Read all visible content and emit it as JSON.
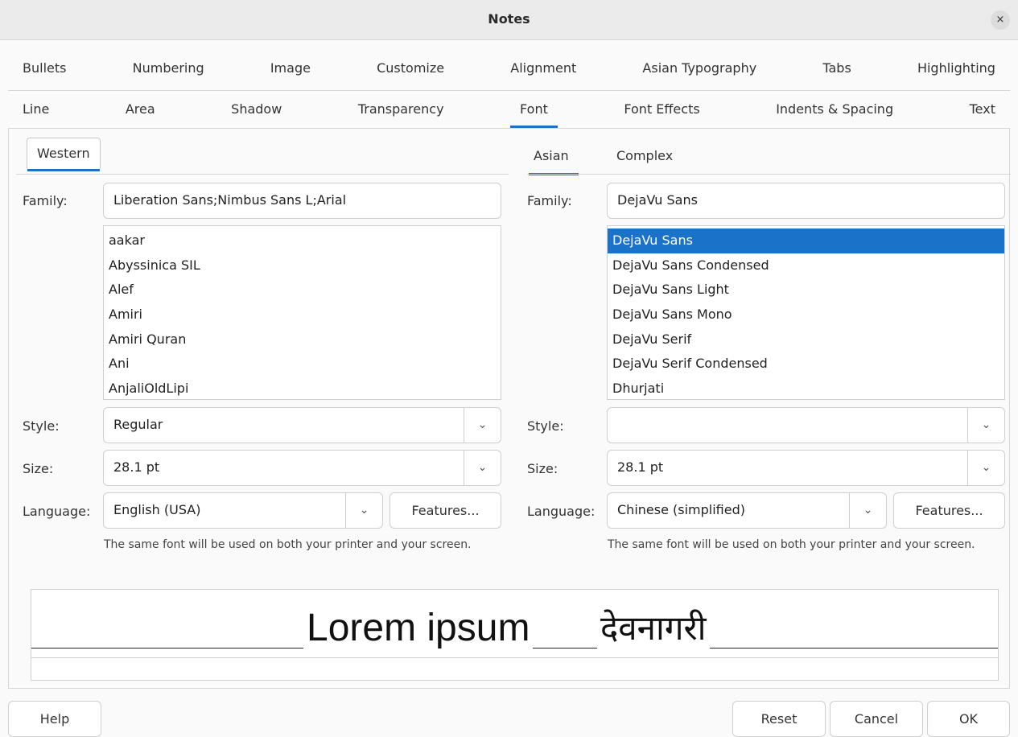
{
  "window": {
    "title": "Notes",
    "close_glyph": "×"
  },
  "tabs_row1": [
    "Bullets",
    "Numbering",
    "Image",
    "Customize",
    "Alignment",
    "Asian Typography",
    "Tabs",
    "Highlighting"
  ],
  "tabs_row2": [
    "Line",
    "Area",
    "Shadow",
    "Transparency",
    "Font",
    "Font Effects",
    "Indents & Spacing",
    "Text"
  ],
  "active_tab": "Font",
  "western": {
    "tab_label": "Western",
    "family_label": "Family:",
    "family_value": "Liberation Sans;Nimbus Sans L;Arial",
    "family_list": [
      "aakar",
      "Abyssinica SIL",
      "Alef",
      "Amiri",
      "Amiri Quran",
      "Ani",
      "AnjaliOldLipi"
    ],
    "style_label": "Style:",
    "style_value": "Regular",
    "size_label": "Size:",
    "size_value": "28.1 pt",
    "language_label": "Language:",
    "language_value": "English (USA)",
    "features_label": "Features...",
    "note": "The same font will be used on both your printer and your screen."
  },
  "asian": {
    "tab_label": "Asian",
    "complex_tab_label": "Complex",
    "family_label": "Family:",
    "family_value": "DejaVu Sans",
    "family_list": [
      "DejaVu Sans",
      "DejaVu Sans Condensed",
      "DejaVu Sans Light",
      "DejaVu Sans Mono",
      "DejaVu Serif",
      "DejaVu Serif Condensed",
      "Dhurjati"
    ],
    "selected_index": 0,
    "style_label": "Style:",
    "style_value": "",
    "size_label": "Size:",
    "size_value": "28.1 pt",
    "language_label": "Language:",
    "language_value": "Chinese (simplified)",
    "features_label": "Features...",
    "note": "The same font will be used on both your printer and your screen."
  },
  "preview": {
    "western_text": "Lorem ipsum",
    "asian_text": "देवनागरी"
  },
  "buttons": {
    "help": "Help",
    "reset": "Reset",
    "cancel": "Cancel",
    "ok": "OK"
  },
  "icons": {
    "dropdown": "chevron-down-icon",
    "close": "close-icon"
  },
  "colors": {
    "accent": "#1a73c9",
    "selection_text": "#ffffff"
  }
}
